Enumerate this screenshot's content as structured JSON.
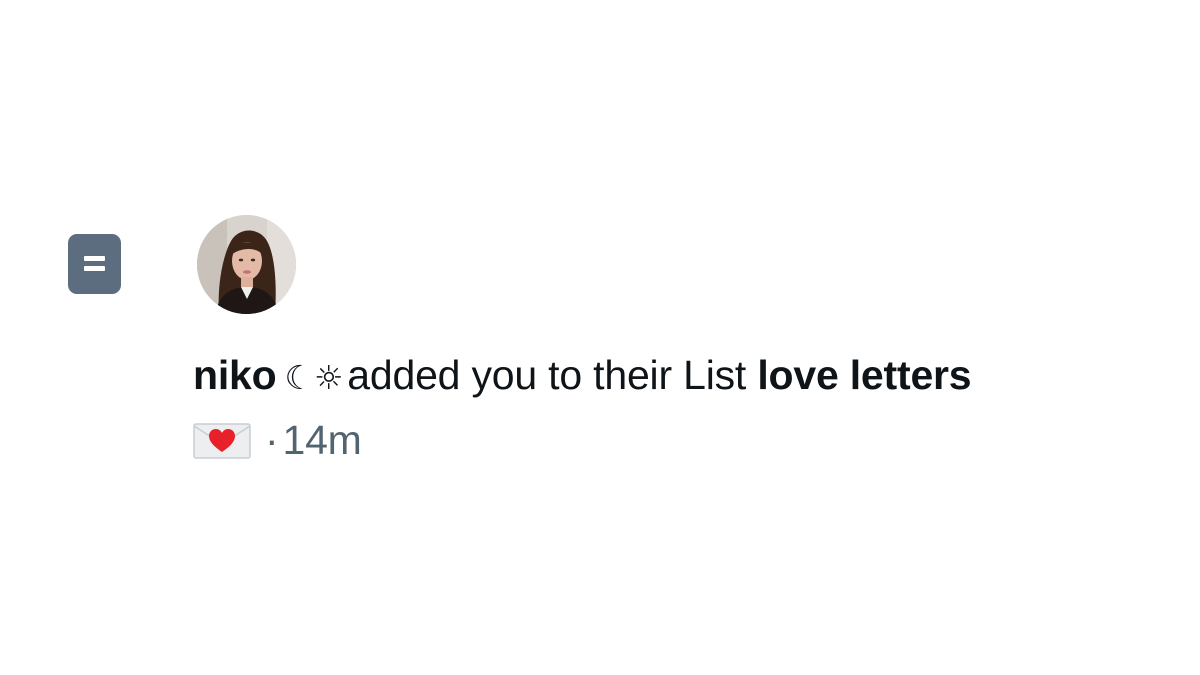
{
  "notification": {
    "type_icon": "list-icon",
    "avatar_icon": "profile-photo",
    "user_name": "niko",
    "name_glyphs": "☾☼",
    "action_text": "added you to their List",
    "list_name": "love letters",
    "list_emoji": "love-letter-icon",
    "separator": "·",
    "timestamp": "14m"
  },
  "colors": {
    "list_icon_bg": "#5b6d7e",
    "text_primary": "#0f1419",
    "text_secondary": "#536471",
    "background": "#ffffff"
  }
}
